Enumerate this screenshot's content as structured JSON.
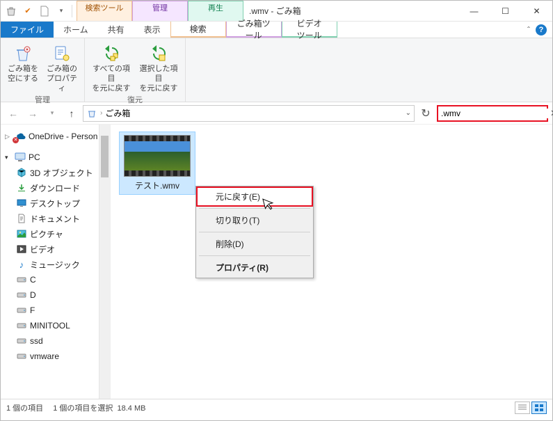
{
  "window": {
    "title": ".wmv - ごみ箱"
  },
  "context_tabs": {
    "search": {
      "header": "検索ツール",
      "sub": "検索"
    },
    "manage": {
      "header": "管理",
      "sub": "ごみ箱ツール"
    },
    "play": {
      "header": "再生",
      "sub": "ビデオ ツール"
    }
  },
  "tabs": {
    "file": "ファイル",
    "home": "ホーム",
    "share": "共有",
    "view": "表示"
  },
  "ribbon": {
    "manage_group": "管理",
    "restore_group": "復元",
    "empty": {
      "l1": "ごみ箱を",
      "l2": "空にする"
    },
    "props": {
      "l1": "ごみ箱の",
      "l2": "プロパティ"
    },
    "restoreall": {
      "l1": "すべての項目",
      "l2": "を元に戻す"
    },
    "restoresel": {
      "l1": "選択した項目",
      "l2": "を元に戻す"
    }
  },
  "breadcrumb": {
    "current": "ごみ箱"
  },
  "search": {
    "value": ".wmv"
  },
  "tree": {
    "onedrive": "OneDrive - Person",
    "pc": "PC",
    "objects3d": "3D オブジェクト",
    "downloads": "ダウンロード",
    "desktop": "デスクトップ",
    "documents": "ドキュメント",
    "pictures": "ピクチャ",
    "videos": "ビデオ",
    "music": "ミュージック",
    "c": "C",
    "d": "D",
    "f": "F",
    "minitool": "MINITOOL",
    "ssd": "ssd",
    "vmware": "vmware"
  },
  "file": {
    "name": "テスト.wmv"
  },
  "context_menu": {
    "restore": "元に戻す(E)",
    "cut": "切り取り(T)",
    "delete": "削除(D)",
    "properties": "プロパティ(R)"
  },
  "status": {
    "count": "1 個の項目",
    "selected": "1 個の項目を選択",
    "size": "18.4 MB"
  }
}
